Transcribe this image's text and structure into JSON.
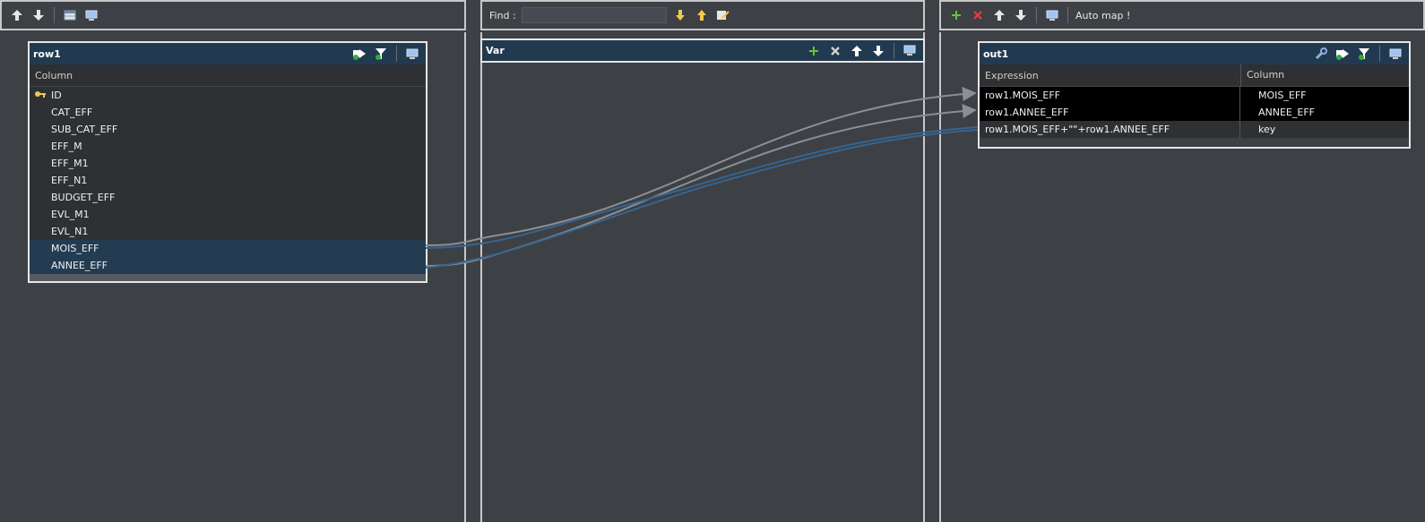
{
  "toolbar_left": {
    "icons": [
      "arrow-up-icon",
      "arrow-down-icon",
      "table-icon",
      "monitor-icon"
    ]
  },
  "toolbar_mid": {
    "find_label": "Find :",
    "find_value": "",
    "icons": [
      "arrow-down-yellow-icon",
      "arrow-up-yellow-icon",
      "search-edit-icon"
    ]
  },
  "toolbar_right": {
    "icons": [
      "add-icon",
      "delete-icon",
      "arrow-up-icon",
      "arrow-down-icon",
      "monitor-icon"
    ],
    "automap_label": "Auto map !"
  },
  "row1": {
    "title": "row1",
    "column_header": "Column",
    "rows": [
      {
        "name": "ID",
        "key": true
      },
      {
        "name": "CAT_EFF"
      },
      {
        "name": "SUB_CAT_EFF"
      },
      {
        "name": "EFF_M"
      },
      {
        "name": "EFF_M1"
      },
      {
        "name": "EFF_N1"
      },
      {
        "name": "BUDGET_EFF"
      },
      {
        "name": "EVL_M1"
      },
      {
        "name": "EVL_N1"
      },
      {
        "name": "MOIS_EFF",
        "selected": true
      },
      {
        "name": "ANNEE_EFF",
        "selected": true
      }
    ]
  },
  "var": {
    "title": "Var"
  },
  "out1": {
    "title": "out1",
    "expression_header": "Expression",
    "column_header": "Column",
    "rows": [
      {
        "expression": "row1.MOIS_EFF",
        "column": "MOIS_EFF"
      },
      {
        "expression": "row1.ANNEE_EFF",
        "column": "ANNEE_EFF"
      },
      {
        "expression": "row1.MOIS_EFF+\"\"+row1.ANNEE_EFF",
        "column": "key"
      }
    ]
  },
  "colors": {
    "header_bg": "#223a4f",
    "selected_row": "#243c52",
    "row_bg": "#2e3033",
    "canvas": "#3d4045"
  }
}
